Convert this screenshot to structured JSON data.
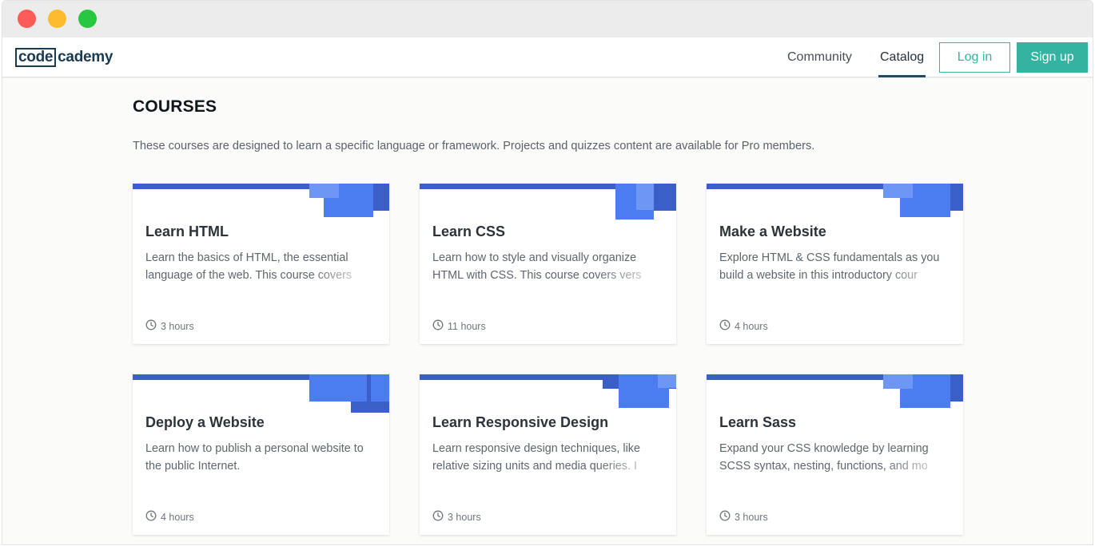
{
  "window": {
    "controls": [
      "close",
      "minimize",
      "zoom"
    ]
  },
  "brand": {
    "logo_boxed": "code",
    "logo_rest": "cademy"
  },
  "nav": {
    "community": "Community",
    "catalog": "Catalog",
    "login": "Log in",
    "signup": "Sign up"
  },
  "colors": {
    "accent": "#34b3a0",
    "card_bar": "#3a5fc9",
    "card_shape": "#4b7cf0"
  },
  "page": {
    "heading": "COURSES",
    "intro": "These courses are designed to learn a specific language or framework. Projects and quizzes content are available for Pro members."
  },
  "courses": [
    {
      "title": "Learn HTML",
      "description": "Learn the basics of HTML, the essential language of the web. This course covers",
      "duration": "3 hours",
      "icon": "clock-icon"
    },
    {
      "title": "Learn CSS",
      "description": "Learn how to style and visually organize HTML with CSS. This course covers vers",
      "duration": "11 hours",
      "icon": "clock-icon"
    },
    {
      "title": "Make a Website",
      "description": "Explore HTML & CSS fundamentals as you build a website in this introductory cour",
      "duration": "4 hours",
      "icon": "clock-icon"
    },
    {
      "title": "Deploy a Website",
      "description": "Learn how to publish a personal website to the public Internet.",
      "duration": "4 hours",
      "icon": "clock-icon"
    },
    {
      "title": "Learn Responsive Design",
      "description": "Learn responsive design techniques, like relative sizing units and media queries. I",
      "duration": "3 hours",
      "icon": "clock-icon"
    },
    {
      "title": "Learn Sass",
      "description": "Expand your CSS knowledge by learning SCSS syntax, nesting, functions, and mo",
      "duration": "3 hours",
      "icon": "clock-icon"
    }
  ]
}
